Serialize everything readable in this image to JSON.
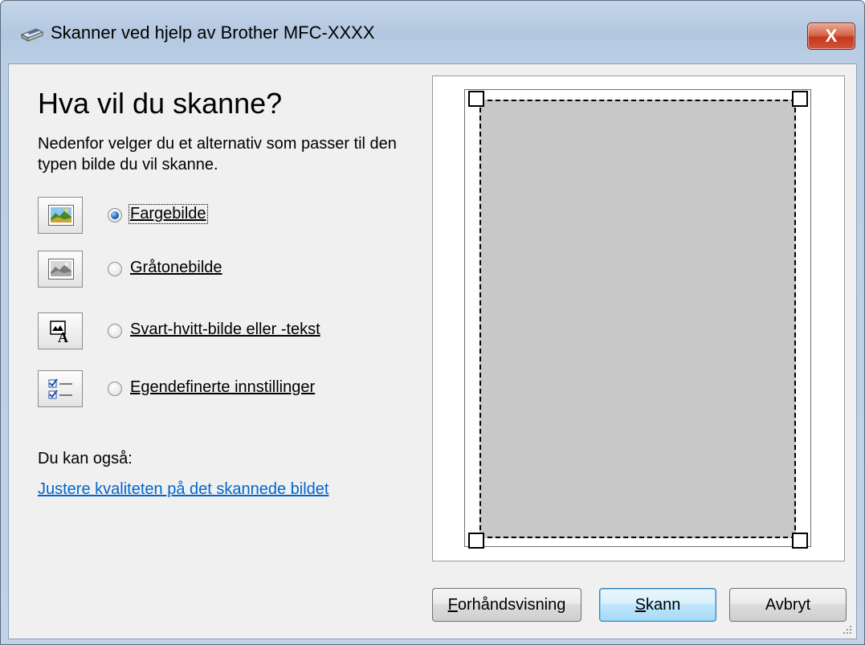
{
  "window": {
    "title": "Skanner ved hjelp av Brother MFC-XXXX",
    "close_label": "X",
    "icon": "scanner-icon"
  },
  "main": {
    "heading": "Hva vil du skanne?",
    "description": "Nedenfor velger du et alternativ som passer til den typen bilde du vil skanne.",
    "options": [
      {
        "label": "Fargebilde",
        "icon": "color-picture-icon",
        "selected": true
      },
      {
        "label": "Gråtonebilde",
        "icon": "grayscale-picture-icon",
        "selected": false
      },
      {
        "label": "Svart-hvitt-bilde eller -tekst",
        "icon": "black-white-text-icon",
        "selected": false
      },
      {
        "label": "Egendefinerte innstillinger",
        "icon": "custom-settings-icon",
        "selected": false
      }
    ],
    "also_label": "Du kan også:",
    "adjust_link": "Justere kvaliteten på det skannede bildet"
  },
  "buttons": {
    "preview_prefix": "F",
    "preview_rest": "orhåndsvisning",
    "scan_prefix": "S",
    "scan_rest": "kann",
    "cancel": "Avbryt"
  },
  "colors": {
    "accent": "#0066cc",
    "close_red": "#c3381c",
    "scan_area": "#c8c8c8"
  }
}
